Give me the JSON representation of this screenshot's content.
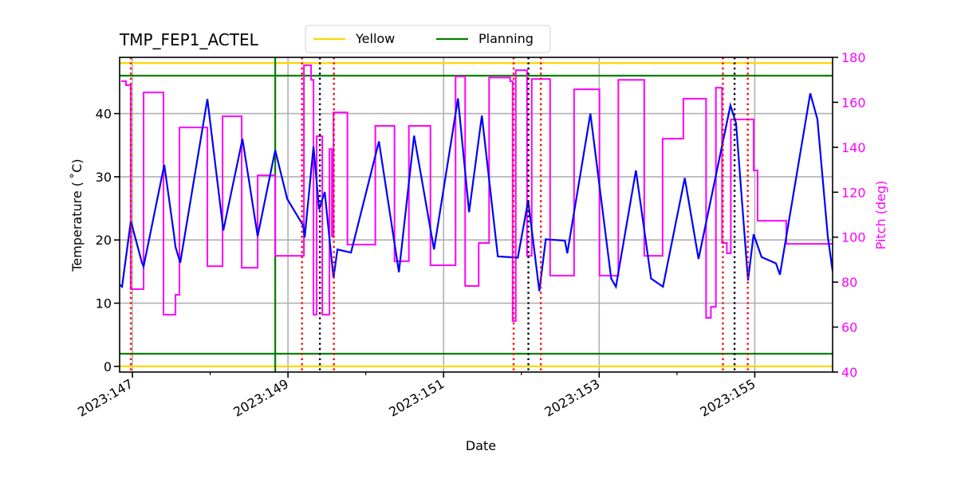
{
  "chart_data": {
    "type": "line",
    "title": "TMP_FEP1_ACTEL",
    "xlabel": "Date",
    "ylabel": "Temperature ($^\\circ$C)",
    "ylabel_display": "Temperature ( ˚C)",
    "y2label": "Pitch (deg)",
    "x_unit": "day-of-year 2023",
    "xlim": [
      146.836,
      156.0
    ],
    "ylim": [
      -0.9,
      48.9
    ],
    "y2lim": [
      40,
      180
    ],
    "grid": true,
    "legend_position": "top-center",
    "x_ticks": [
      {
        "value": 147,
        "label": "2023:147"
      },
      {
        "value": 149,
        "label": "2023:149"
      },
      {
        "value": 151,
        "label": "2023:151"
      },
      {
        "value": 153,
        "label": "2023:153"
      },
      {
        "value": 155,
        "label": "2023:155"
      }
    ],
    "x_minor_ticks": [
      148,
      150,
      152,
      154
    ],
    "y_ticks": [
      0,
      10,
      20,
      30,
      40
    ],
    "y2_ticks": [
      40,
      60,
      80,
      100,
      120,
      140,
      160,
      180
    ],
    "colors": {
      "temperature": "#0000ff",
      "pitch": "#ff00ff",
      "yellow_limit": "#ffd700",
      "planning_limit": "#008000",
      "grid": "#b0b0b0",
      "event_red": "#ff0000",
      "event_black": "#000000",
      "y2_axis": "#ff00ff"
    },
    "legend": [
      {
        "name": "Yellow",
        "color": "#ffd700"
      },
      {
        "name": "Planning",
        "color": "#008000"
      }
    ],
    "limits": {
      "yellow": [
        0,
        48.0
      ],
      "planning": [
        2.0,
        46.0
      ]
    },
    "planning_vertical_x": 148.836,
    "event_lines": [
      {
        "x": 146.98,
        "color": "red"
      },
      {
        "x": 149.18,
        "color": "red"
      },
      {
        "x": 149.41,
        "color": "black"
      },
      {
        "x": 149.59,
        "color": "red"
      },
      {
        "x": 151.9,
        "color": "red"
      },
      {
        "x": 152.09,
        "color": "black"
      },
      {
        "x": 152.25,
        "color": "red"
      },
      {
        "x": 154.59,
        "color": "red"
      },
      {
        "x": 154.74,
        "color": "black"
      },
      {
        "x": 154.91,
        "color": "red"
      }
    ],
    "series": [
      {
        "name": "TMP_FEP1_ACTEL",
        "axis": "left",
        "x": [
          146.836,
          146.867,
          146.98,
          147.123,
          147.144,
          147.41,
          147.533,
          147.554,
          147.615,
          147.964,
          148.169,
          148.415,
          148.61,
          148.836,
          148.99,
          149.195,
          149.215,
          149.328,
          149.4,
          149.472,
          149.585,
          149.636,
          149.81,
          150.169,
          150.426,
          150.621,
          150.877,
          151.185,
          151.328,
          151.492,
          151.697,
          151.954,
          152.087,
          152.231,
          152.313,
          152.559,
          152.59,
          152.887,
          153.154,
          153.215,
          153.472,
          153.667,
          153.82,
          154.1,
          154.277,
          154.687,
          154.759,
          154.913,
          154.985,
          155.087,
          155.272,
          155.323,
          155.713,
          155.805,
          155.938,
          156.0
        ],
        "values": [
          12.9,
          12.6,
          23.0,
          16.4,
          15.8,
          31.9,
          21.0,
          18.9,
          16.4,
          42.3,
          21.5,
          36.0,
          20.6,
          34.2,
          26.5,
          22.3,
          20.4,
          34.8,
          24.8,
          27.6,
          14.0,
          18.5,
          18.0,
          35.6,
          14.9,
          36.5,
          18.5,
          42.4,
          24.4,
          39.7,
          17.4,
          17.2,
          26.2,
          11.9,
          20.1,
          19.9,
          17.9,
          40.0,
          13.9,
          12.6,
          31.0,
          13.9,
          12.6,
          29.8,
          17.0,
          41.3,
          38.5,
          13.6,
          20.9,
          17.3,
          16.3,
          14.5,
          43.2,
          39.1,
          20.6,
          15.1
        ]
      },
      {
        "name": "Pitch",
        "axis": "right",
        "step": true,
        "x": [
          146.856,
          146.918,
          146.979,
          147.144,
          147.4,
          147.554,
          147.605,
          147.964,
          148.159,
          148.405,
          148.61,
          148.836,
          149.205,
          149.297,
          149.328,
          149.369,
          149.441,
          149.533,
          149.564,
          149.585,
          149.764,
          150.123,
          150.369,
          150.554,
          150.831,
          151.154,
          151.277,
          151.451,
          151.585,
          151.856,
          151.887,
          151.928,
          152.072,
          152.133,
          152.369,
          152.677,
          153.004,
          153.246,
          153.579,
          153.815,
          154.082,
          154.374,
          154.436,
          154.5,
          154.579,
          154.641,
          154.692,
          154.985,
          155.036,
          155.405,
          155.497,
          155.528,
          156.0
        ],
        "values": [
          169.4,
          167.6,
          76.9,
          164.4,
          65.5,
          74.4,
          148.8,
          87.1,
          153.8,
          86.4,
          127.5,
          91.7,
          176.5,
          170.0,
          65.5,
          144.9,
          65.5,
          139.2,
          100.3,
          155.5,
          96.7,
          149.5,
          89.3,
          149.5,
          87.5,
          171.5,
          78.3,
          97.4,
          171.0,
          169.4,
          62.7,
          174.3,
          91.7,
          170.4,
          82.9,
          165.8,
          82.9,
          170.0,
          91.7,
          143.8,
          161.6,
          64.1,
          69.0,
          166.5,
          97.4,
          92.8,
          152.4,
          129.7,
          107.3,
          97.0,
          97.0,
          97.0,
          97.0
        ]
      }
    ]
  }
}
